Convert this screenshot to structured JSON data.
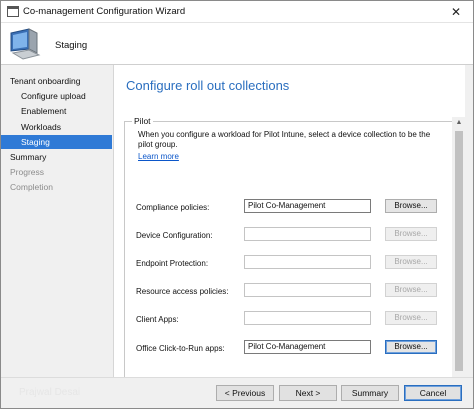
{
  "window": {
    "title": "Co-management Configuration Wizard",
    "close_glyph": "✕"
  },
  "header": {
    "title": "Staging"
  },
  "nav": {
    "items": [
      {
        "label": "Tenant onboarding"
      },
      {
        "label": "Configure upload"
      },
      {
        "label": "Enablement"
      },
      {
        "label": "Workloads"
      },
      {
        "label": "Staging"
      },
      {
        "label": "Summary"
      },
      {
        "label": "Progress"
      },
      {
        "label": "Completion"
      }
    ]
  },
  "main": {
    "page_title": "Configure roll out collections",
    "group_label": "Pilot",
    "description": "When you configure a workload for Pilot Intune, select a device collection to be the pilot group.",
    "learn_more": "Learn more",
    "rows": [
      {
        "label": "Compliance policies:",
        "value": "Pilot Co-Management",
        "button": "Browse..."
      },
      {
        "label": "Device Configuration:",
        "value": "",
        "button": "Browse..."
      },
      {
        "label": "Endpoint Protection:",
        "value": "",
        "button": "Browse..."
      },
      {
        "label": "Resource access policies:",
        "value": "",
        "button": "Browse..."
      },
      {
        "label": "Client Apps:",
        "value": "",
        "button": "Browse..."
      },
      {
        "label": "Office Click-to-Run apps:",
        "value": "Pilot Co-Management",
        "button": "Browse..."
      }
    ]
  },
  "footer": {
    "watermark": "Prajwal Desai",
    "previous": "< Previous",
    "next": "Next >",
    "summary": "Summary",
    "cancel": "Cancel"
  },
  "colors": {
    "accent": "#2f7ad6",
    "page_title": "#2a6ebf",
    "link": "#0b56c9"
  },
  "icons": {
    "app": "wizard-window-icon",
    "header": "computer-monitor-icon",
    "scroll_up": "scroll-up-arrow-icon"
  }
}
